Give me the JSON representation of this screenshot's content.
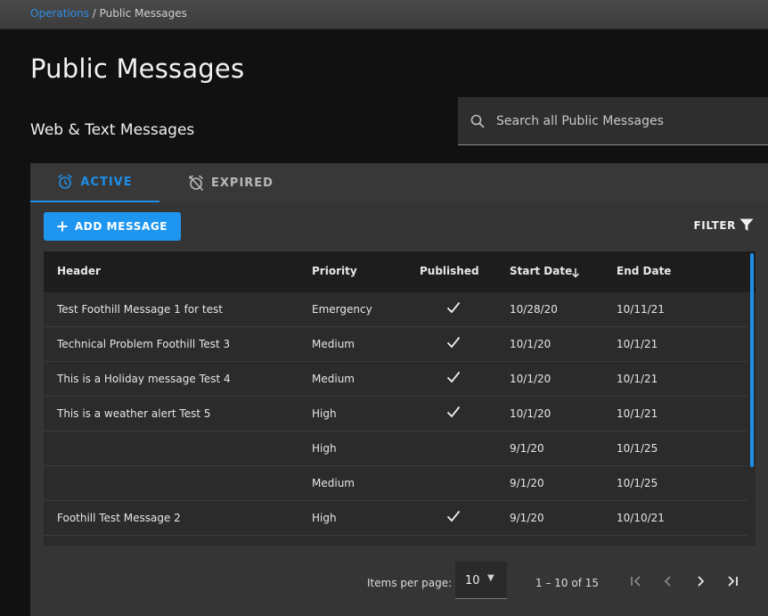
{
  "breadcrumb": {
    "parent": "Operations",
    "separator": " / ",
    "current": "Public Messages"
  },
  "page_title": "Public Messages",
  "section_title": "Web & Text Messages",
  "search": {
    "placeholder": "Search all Public Messages",
    "value": "",
    "icon": "search-icon"
  },
  "tabs": [
    {
      "label": "ACTIVE",
      "icon": "alarm-clock-icon",
      "active": true
    },
    {
      "label": "EXPIRED",
      "icon": "alarm-off-icon",
      "active": false
    }
  ],
  "toolbar": {
    "add_label": "ADD MESSAGE",
    "filter_label": "FILTER"
  },
  "table": {
    "columns": [
      "Header",
      "Priority",
      "Published",
      "Start Date",
      "End Date"
    ],
    "sort": {
      "column": "Start Date",
      "direction": "desc"
    },
    "rows": [
      {
        "header": "Test Foothill Message 1 for test",
        "priority": "Emergency",
        "published": true,
        "start": "10/28/20",
        "end": "10/11/21"
      },
      {
        "header": "Technical Problem Foothill Test 3",
        "priority": "Medium",
        "published": true,
        "start": "10/1/20",
        "end": "10/1/21"
      },
      {
        "header": "This is a Holiday message Test 4",
        "priority": "Medium",
        "published": true,
        "start": "10/1/20",
        "end": "10/1/21"
      },
      {
        "header": "This is a weather alert Test 5",
        "priority": "High",
        "published": true,
        "start": "10/1/20",
        "end": "10/1/21"
      },
      {
        "header": "",
        "priority": "High",
        "published": false,
        "start": "9/1/20",
        "end": "10/1/25"
      },
      {
        "header": "",
        "priority": "Medium",
        "published": false,
        "start": "9/1/20",
        "end": "10/1/25"
      },
      {
        "header": "Foothill Test Message 2",
        "priority": "High",
        "published": true,
        "start": "9/1/20",
        "end": "10/10/21"
      }
    ]
  },
  "pagination": {
    "items_per_page_label": "Items per page:",
    "items_per_page": "10",
    "range": "1 – 10 of 15"
  },
  "colors": {
    "accent": "#1e8ee8",
    "button": "#1e96f0",
    "background": "#111111",
    "card": "#353535"
  }
}
